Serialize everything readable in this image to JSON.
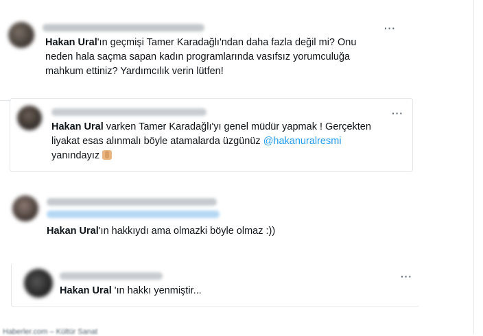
{
  "tweets": [
    {
      "author_name": "Hakan Ural",
      "text_rest": "'ın geçmişi Tamer Karadağlı'ndan daha fazla değil mi? Onu neden hala saçma sapan kadın programlarında vasıfsız yorumculuğa mahkum ettiniz? Yardımcılık verin lütfen!",
      "more_label": "···"
    },
    {
      "author_name": "Hakan Ural",
      "text_before_mention": " varken Tamer Karadağlı'yı genel müdür yapmak ! Gerçekten liyakat esas alınmalı böyle atamalarda üzgünüz ",
      "mention": "@hakanuralresmi",
      "text_after_mention": " yanındayız",
      "emoji": "folded-hands",
      "more_label": "···"
    },
    {
      "author_name": "Hakan Ural",
      "text_rest": "'ın hakkıydı ama olmazki böyle olmaz :))",
      "more_label": "···"
    },
    {
      "author_name": "Hakan Ural",
      "text_rest": " 'ın hakkı yenmiştir...",
      "more_label": "···"
    }
  ],
  "footer": {
    "text": "Haberler.com – Kültür Sanat"
  },
  "colors": {
    "text": "#0f1419",
    "link": "#1d9bf0",
    "muted": "#536471",
    "border": "#e4e7ea"
  }
}
